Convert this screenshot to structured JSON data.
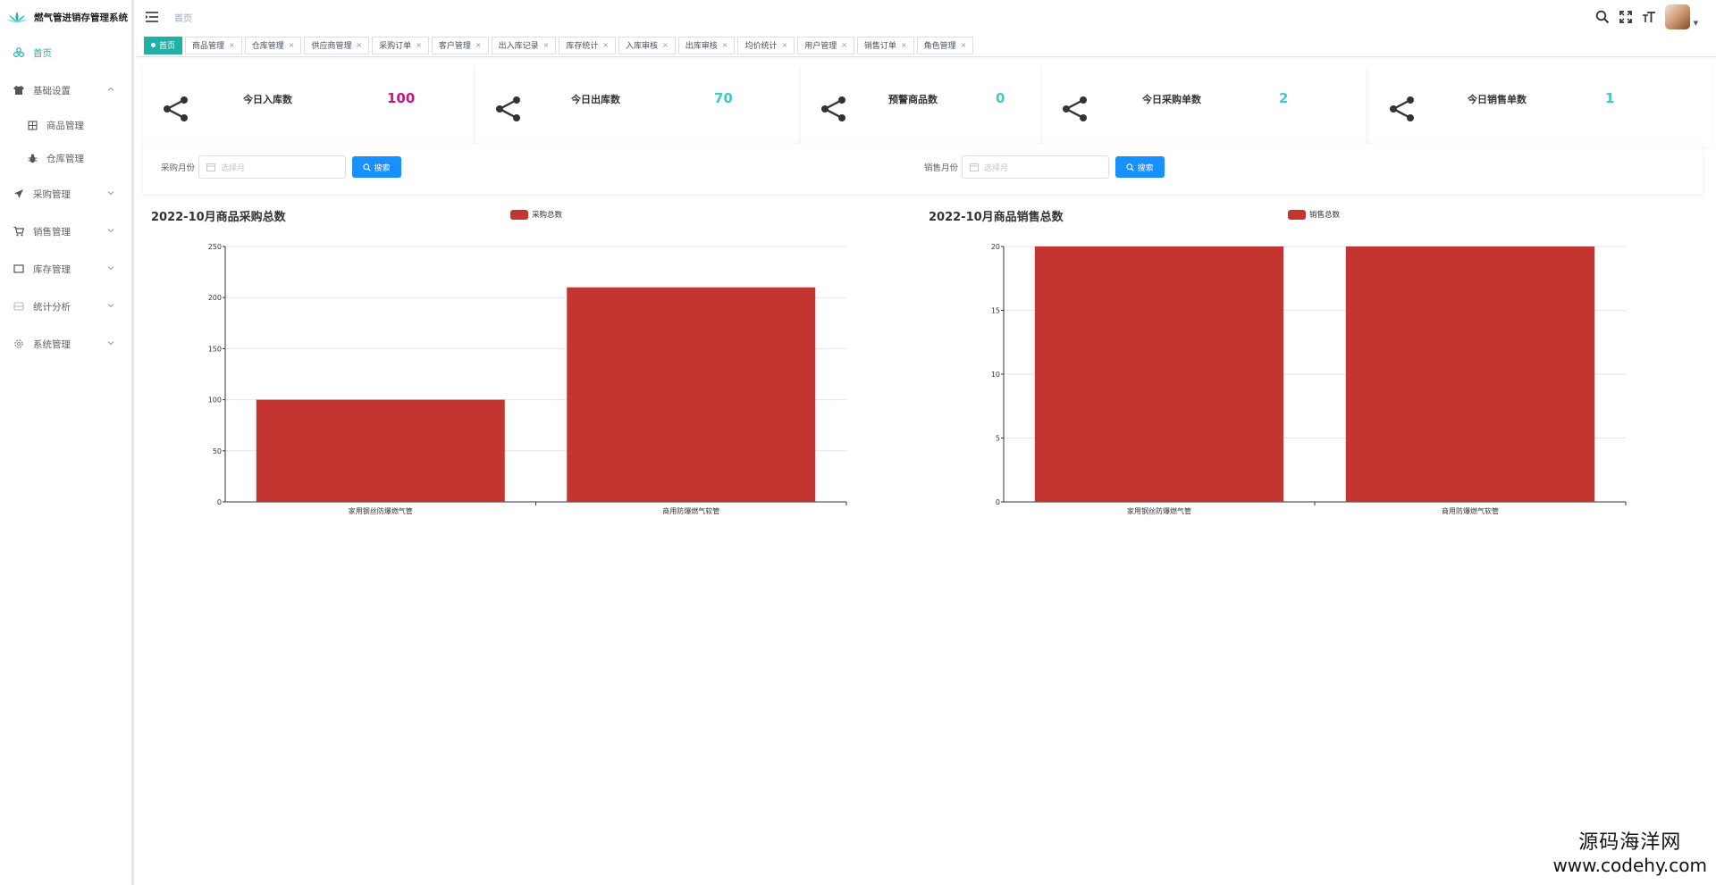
{
  "app": {
    "title": "燃气管进销存管理系统"
  },
  "sidebar": {
    "items": [
      {
        "label": "首页",
        "icon": "dashboard-icon",
        "active": true
      },
      {
        "label": "基础设置",
        "icon": "shirt-icon",
        "expanded": true
      },
      {
        "label": "商品管理",
        "icon": "grid-icon",
        "sub": true
      },
      {
        "label": "仓库管理",
        "icon": "bug-icon",
        "sub": true
      },
      {
        "label": "采购管理",
        "icon": "send-icon"
      },
      {
        "label": "销售管理",
        "icon": "cart-icon"
      },
      {
        "label": "库存管理",
        "icon": "box-icon"
      },
      {
        "label": "统计分析",
        "icon": "chart-icon"
      },
      {
        "label": "系统管理",
        "icon": "gear-icon"
      }
    ]
  },
  "header": {
    "breadcrumb": "首页"
  },
  "tags": [
    {
      "label": "首页",
      "active": true
    },
    {
      "label": "商品管理"
    },
    {
      "label": "仓库管理"
    },
    {
      "label": "供应商管理"
    },
    {
      "label": "采购订单"
    },
    {
      "label": "客户管理"
    },
    {
      "label": "出入库记录"
    },
    {
      "label": "库存统计"
    },
    {
      "label": "入库审核"
    },
    {
      "label": "出库审核"
    },
    {
      "label": "均价统计"
    },
    {
      "label": "用户管理"
    },
    {
      "label": "销售订单"
    },
    {
      "label": "角色管理"
    }
  ],
  "stats": [
    {
      "label": "今日入库数",
      "value": "100",
      "color": "#c71585"
    },
    {
      "label": "今日出库数",
      "value": "70",
      "color": "#40c9c6"
    },
    {
      "label": "预警商品数",
      "value": "0",
      "color": "#40c9c6"
    },
    {
      "label": "今日采购单数",
      "value": "2",
      "color": "#40c9c6"
    },
    {
      "label": "今日销售单数",
      "value": "1",
      "color": "#40c9c6"
    }
  ],
  "search": {
    "purchase_label": "采购月份",
    "sales_label": "销售月份",
    "placeholder": "选择月",
    "button": "搜索"
  },
  "chart_data": [
    {
      "type": "bar",
      "title": "2022-10月商品采购总数",
      "categories": [
        "家用钢丝防爆燃气管",
        "商用防爆燃气软管"
      ],
      "series": [
        {
          "name": "采购总数",
          "values": [
            100,
            210
          ]
        }
      ],
      "ylim": [
        0,
        250
      ],
      "yticks": [
        0,
        50,
        100,
        150,
        200,
        250
      ],
      "grid": true,
      "legend": "top-center",
      "color": "#c23531"
    },
    {
      "type": "bar",
      "title": "2022-10月商品销售总数",
      "categories": [
        "家用钢丝防爆燃气管",
        "商用防爆燃气软管"
      ],
      "series": [
        {
          "name": "销售总数",
          "values": [
            20,
            20
          ]
        }
      ],
      "ylim": [
        0,
        20
      ],
      "yticks": [
        0,
        5,
        10,
        15,
        20
      ],
      "grid": true,
      "legend": "top-center",
      "color": "#c23531"
    }
  ],
  "watermark": {
    "name": "源码海洋网",
    "url": "www.codehy.com"
  }
}
